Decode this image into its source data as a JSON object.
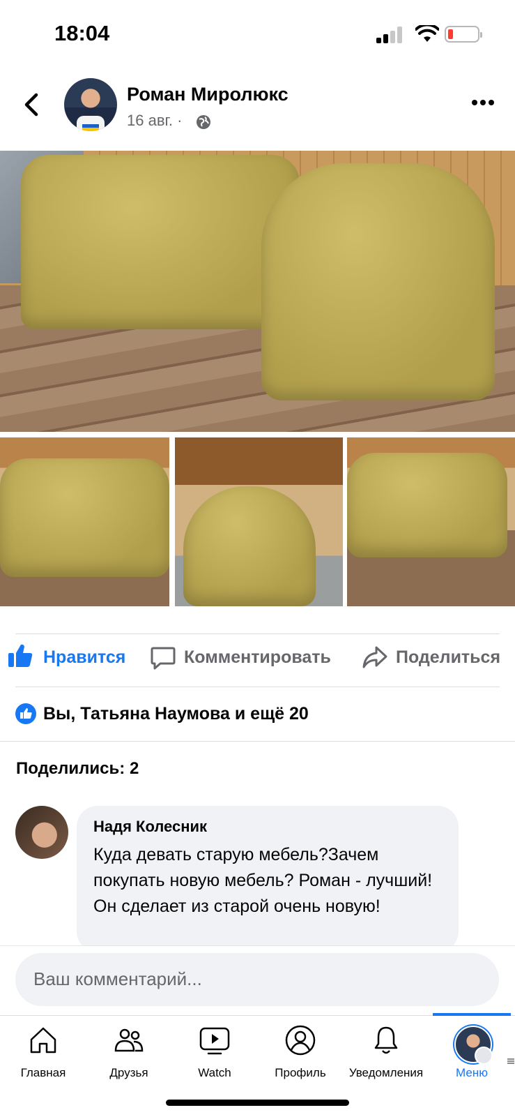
{
  "status_bar": {
    "time": "18:04"
  },
  "post": {
    "author": "Роман Миролюкс",
    "date": "16 авг.",
    "date_separator": "·"
  },
  "actions": {
    "like": "Нравится",
    "comment": "Комментировать",
    "share": "Поделиться"
  },
  "reactions": {
    "summary": "Вы, Татьяна Наумова и ещё 20"
  },
  "shares": {
    "label": "Поделились: 2"
  },
  "comment": {
    "author": "Надя Колесник",
    "text": "Куда девать старую мебель?Зачем покупать новую мебель? Роман - лучший! Он сделает из старой очень новую!"
  },
  "composer": {
    "placeholder": "Ваш комментарий..."
  },
  "tabbar": {
    "items": [
      {
        "label": "Главная"
      },
      {
        "label": "Друзья"
      },
      {
        "label": "Watch"
      },
      {
        "label": "Профиль"
      },
      {
        "label": "Уведомления"
      },
      {
        "label": "Меню"
      }
    ]
  },
  "colors": {
    "accent": "#1877f2",
    "secondary_text": "#65676b",
    "bubble": "#f0f2f5"
  }
}
